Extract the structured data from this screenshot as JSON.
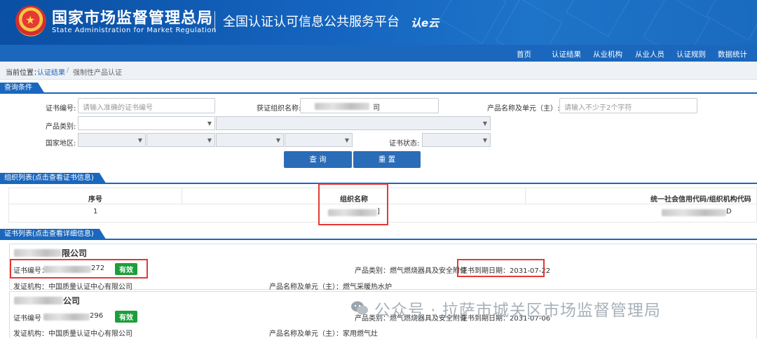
{
  "header": {
    "org_cn": "国家市场监督管理总局",
    "org_en": "State Administration  for  Market Regulation",
    "platform": "全国认证认可信息公共服务平台",
    "logo_text": "认e云"
  },
  "nav": {
    "items": [
      "首页",
      "认证结果",
      "从业机构",
      "从业人员",
      "认证规则",
      "数据统计"
    ]
  },
  "breadcrumb": {
    "prefix": "当前位置：",
    "link": "认证结果",
    "sep": "/",
    "current": "强制性产品认证"
  },
  "query": {
    "title": "查询条件",
    "cert_no_label": "证书编号:",
    "cert_no_placeholder": "请输入准确的证书编号",
    "org_name_label": "获证组织名称:",
    "org_name_suffix": "司",
    "product_label": "产品名称及单元（主）:",
    "product_placeholder": "请输入不少于2个字符",
    "category_label": "产品类别:",
    "region_label": "国家地区:",
    "status_label": "证书状态:",
    "search_button": "查 询",
    "reset_button": "重 置"
  },
  "org_list": {
    "title": "组织列表(点击查看证书信息)",
    "col_no": "序号",
    "col_name": "组织名称",
    "col_code": "统一社会信用代码/组织机构代码",
    "rows": [
      {
        "no": "1",
        "name_tail": "]",
        "code_tail": "D"
      }
    ]
  },
  "cert_list": {
    "title": "证书列表(点击查看详细信息)",
    "cards": [
      {
        "company_tail": "限公司",
        "cert_no_label": "证书编号：",
        "cert_no_tail": "272",
        "status": "有效",
        "category": "产品类别：燃气燃烧器具及安全附件",
        "expiry": "证书到期日期：2031-07-22",
        "issuer": "发证机构：中国质量认证中心有限公司",
        "product": "产品名称及单元（主）：燃气采暖热水炉"
      },
      {
        "company_tail": "公司",
        "cert_no_label": "证书编号",
        "cert_no_tail": "296",
        "status": "有效",
        "category": "产品类别：燃气燃烧器具及安全附件",
        "expiry": "证书到期日期：2031-07-06",
        "issuer": "发证机构：中国质量认证中心有限公司",
        "product": "产品名称及单元（主）：家用燃气灶"
      }
    ]
  },
  "watermark": "公众号 · 拉萨市城关区市场监督管理局",
  "colors": {
    "primary": "#1a67bd",
    "badge": "#1e9e3b",
    "highlight": "#e53935"
  }
}
